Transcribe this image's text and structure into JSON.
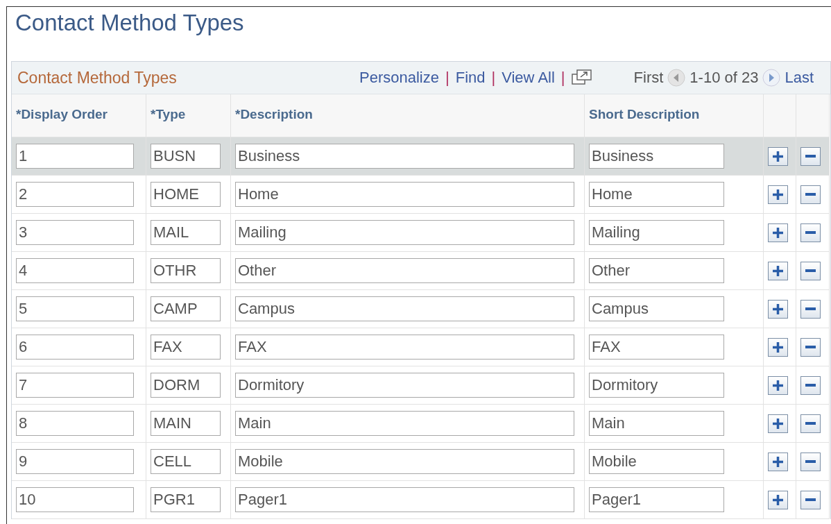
{
  "page_title": "Contact Method Types",
  "grid": {
    "title": "Contact Method Types",
    "toolbar_links": [
      "Personalize",
      "Find",
      "View All"
    ],
    "separator": "|",
    "paging": {
      "first": "First",
      "range": "1-10 of 23",
      "last": "Last"
    },
    "columns": [
      "*Display Order",
      "*Type",
      "*Description",
      "Short Description"
    ],
    "rows": [
      {
        "display_order": "1",
        "type": "BUSN",
        "description": "Business",
        "short_description": "Business",
        "selected": true
      },
      {
        "display_order": "2",
        "type": "HOME",
        "description": "Home",
        "short_description": "Home",
        "selected": false
      },
      {
        "display_order": "3",
        "type": "MAIL",
        "description": "Mailing",
        "short_description": "Mailing",
        "selected": false
      },
      {
        "display_order": "4",
        "type": "OTHR",
        "description": "Other",
        "short_description": "Other",
        "selected": false
      },
      {
        "display_order": "5",
        "type": "CAMP",
        "description": "Campus",
        "short_description": "Campus",
        "selected": false
      },
      {
        "display_order": "6",
        "type": "FAX",
        "description": "FAX",
        "short_description": "FAX",
        "selected": false
      },
      {
        "display_order": "7",
        "type": "DORM",
        "description": "Dormitory",
        "short_description": "Dormitory",
        "selected": false
      },
      {
        "display_order": "8",
        "type": "MAIN",
        "description": "Main",
        "short_description": "Main",
        "selected": false
      },
      {
        "display_order": "9",
        "type": "CELL",
        "description": "Mobile",
        "short_description": "Mobile",
        "selected": false
      },
      {
        "display_order": "10",
        "type": "PGR1",
        "description": "Pager1",
        "short_description": "Pager1",
        "selected": false
      }
    ]
  }
}
